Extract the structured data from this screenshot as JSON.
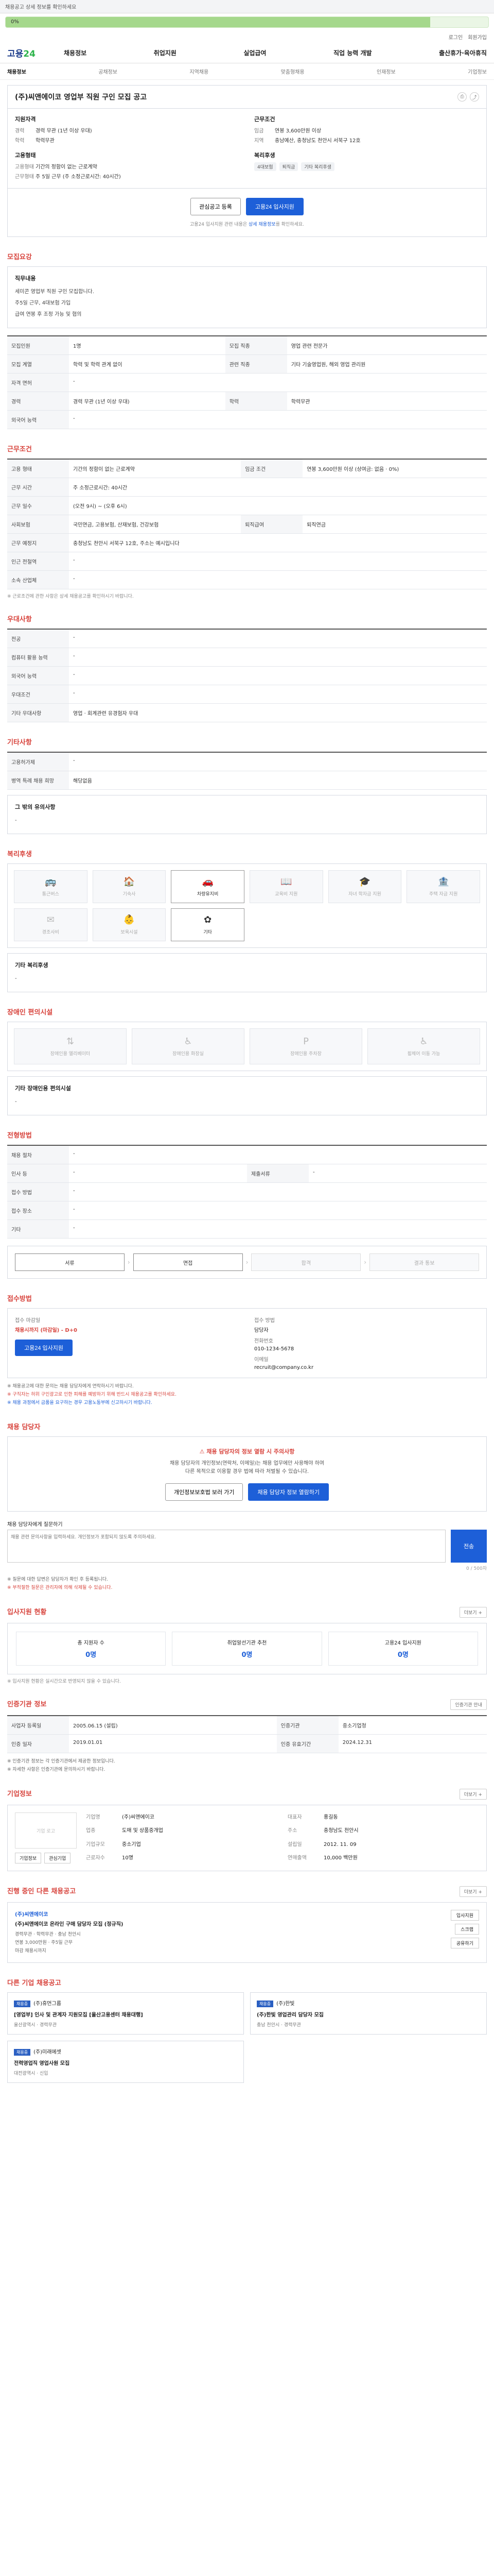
{
  "topbar": {
    "text": "채용공고 상세 정보를 확인하세요"
  },
  "progress": {
    "text": "0%",
    "fraction": 0.88
  },
  "util": [
    "로그인",
    "회원가입"
  ],
  "gnb": {
    "logo_main": "고용",
    "logo_accent": "24",
    "menu": [
      "채용정보",
      "취업지원",
      "실업급여",
      "직업 능력 개발",
      "출산휴가·육아휴직"
    ]
  },
  "subnav": [
    "채용정보",
    "공채정보",
    "지역채용",
    "맞춤형채용",
    "인재정보",
    "기업정보"
  ],
  "job": {
    "title": "(주)씨앤에이코 영업부 직원 구인 모집 공고",
    "recruit_label": "지원자격",
    "recruit_rows": [
      [
        "경력",
        "경력 무관 (1년 이상 우대)"
      ],
      [
        "학력",
        "학력무관"
      ]
    ],
    "cond_label": "근무조건",
    "cond_rows": [
      [
        "임금",
        "연봉 3,600만원 이상"
      ],
      [
        "지역",
        "충남예산, 충청남도 천안시 서북구 12호"
      ]
    ],
    "form_label": "고용형태",
    "form_rows": [
      [
        "고용형태",
        "기간의 정함이 없는 근로계약"
      ],
      [
        "근무형태",
        "주 5일 근무 (주 소정근로시간: 40시간)"
      ]
    ],
    "benefit_label": "복리후생",
    "benefit_chips": [
      "4대보험",
      "퇴직금",
      "기타 복리후생"
    ]
  },
  "cta": {
    "scrap": "관심공고 등록",
    "apply": "고용24 입사지원",
    "note_pre": "고용24 입사지원 관련 내용은",
    "note_link": "상세 채용정보",
    "note_post": "를 확인하세요."
  },
  "sec": {
    "job_desc": "모집요강",
    "conditions": "근무조건",
    "prefer": "우대사항",
    "etc": "기타사항",
    "welfare": "복리후생",
    "disability": "장애인 편의시설",
    "process": "전형방법",
    "apply": "접수방법",
    "manager": "채용 담당자",
    "apply_status": "입사지원 현황",
    "cert": "인증기관 정보",
    "company": "기업정보",
    "other": "진행 중인 다른 채용공고",
    "similar": "다른 기업 채용공고"
  },
  "desc": {
    "heading": "직무내용",
    "lines": [
      "세미콘 영업부 직원 구인 모집합니다.",
      "주5일 근무, 4대보험 가입",
      "급여 연봉 후 조정 가능 및 협의"
    ]
  },
  "rows": {
    "recruit": [
      [
        "모집인원",
        "1명",
        "모집 직종",
        "영업 관련 전문가"
      ],
      [
        "모집 계열",
        "학력 및 학력 관계 없이",
        "관련 직종",
        "기타 기술영업원, 해외 영업 관리원"
      ],
      [
        "자격 면허",
        "-",
        "",
        ""
      ],
      [
        "경력",
        "경력 무관 (1년 이상 우대)",
        "학력",
        "학력무관"
      ],
      [
        "외국어 능력",
        "-",
        "",
        ""
      ]
    ],
    "conditions": [
      [
        "고용 형태",
        "기간의 정함이 없는 근로계약",
        "임금 조건",
        "연봉 3,600만원 이상 (상여금: 없음 · 0%)"
      ],
      [
        "근무 시간",
        "주 소정근로시간: 40시간",
        "",
        ""
      ],
      [
        "근무 일수",
        "(오전 9시) ~ (오후 6시)",
        "",
        ""
      ],
      [
        "사회보험",
        "국민연금, 고용보험, 산재보험, 건강보험",
        "퇴직급여",
        "퇴직연금"
      ],
      [
        "근무 예정지",
        "충청남도 천안시 서북구 12호, 주소는 예시입니다",
        "",
        ""
      ],
      [
        "인근 전철역",
        "-",
        "",
        ""
      ],
      [
        "소속 산업체",
        "-",
        "",
        ""
      ]
    ],
    "conditions_note": "※ 근로조건에 관한 사항은 상세 채용공고를 확인하시기 바랍니다.",
    "prefer": [
      [
        "전공",
        "-"
      ],
      [
        "컴퓨터 활용 능력",
        "-"
      ],
      [
        "외국어 능력",
        "-"
      ],
      [
        "우대조건",
        "-"
      ],
      [
        "기타 우대사항",
        "영업 · 회계관련 유경험자 우대"
      ]
    ],
    "etc": [
      [
        "고용허가제",
        "-"
      ],
      [
        "병역 특례 채용 희망",
        "해당없음"
      ]
    ],
    "etc_sub": "그 밖의 유의사항",
    "welfare_icons": [
      "통근버스",
      "기숙사",
      "차량유지비",
      "교육비 지원",
      "자녀 학자금 지원",
      "주택 자금 지원",
      "경조사비",
      "보육시설",
      "기타"
    ],
    "welfare_on": [
      2,
      8
    ],
    "welfare_other_label": "기타 복리후생",
    "disability_icons": [
      "장애인용 엘리베이터",
      "장애인용 화장실",
      "장애인용 주차장",
      "휠체어 이동 가능"
    ],
    "disability_other_label": "기타 장애인용 편의시설",
    "process": [
      [
        "채용 절차",
        "-",
        "",
        ""
      ],
      [
        "인사 등",
        "-",
        "제출서류",
        "-"
      ],
      [
        "접수 방법",
        "-",
        "",
        ""
      ],
      [
        "접수 장소",
        "-",
        "",
        ""
      ],
      [
        "기타",
        "-",
        "",
        ""
      ]
    ],
    "steps": [
      "서류",
      "면접",
      "합격",
      "결과 통보"
    ],
    "steps_on": [
      0,
      1
    ]
  },
  "apply_block": {
    "period_label": "접수 마감일",
    "period_value": "채용시까지 (마감일) - D+0",
    "btn": "고용24 입사지원",
    "manager_label": "접수 방법",
    "manager_value": "담당자",
    "phone_label": "전화번호",
    "phone_value": "010-1234-5678",
    "email_label": "이메일",
    "email_value": "recruit@company.co.kr"
  },
  "apply_notes": [
    "※ 채용공고에 대한 문의는 채용 담당자에게 연락하시기 바랍니다.",
    "※ 구직자는 허위 구인광고로 인한 피해를 예방하기 위해 반드시 채용공고를 확인하세요.",
    "※ 채용 과정에서 금품을 요구하는 경우 고용노동부에 신고하시기 바랍니다."
  ],
  "alert": {
    "title": "채용 담당자의 정보 열람 시 주의사항",
    "desc1": "채용 담당자의 개인정보(연락처, 이메일)는 채용 업무에만 사용해야 하며",
    "desc2": "다른 목적으로 이용할 경우 법에 따라 처벌될 수 있습니다.",
    "btn1": "개인정보보호법 보러 가기",
    "btn2": "채용 담당자 정보 열람하기"
  },
  "question": {
    "label": "채용 담당자에게 질문하기",
    "placeholder": "채용 관련 문의사항을 입력하세요. 개인정보가 포함되지 않도록 주의하세요.",
    "btn": "전송",
    "counter": "0 / 500자"
  },
  "q_notes": [
    "※ 질문에 대한 답변은 담당자가 확인 후 등록됩니다.",
    "※ 부적절한 질문은 관리자에 의해 삭제될 수 있습니다."
  ],
  "status": {
    "items": [
      [
        "총 지원자 수",
        "0명"
      ],
      [
        "취업알선기관 추천",
        "0명"
      ],
      [
        "고용24 입사지원",
        "0명"
      ]
    ],
    "more": "더보기 +",
    "note": "※ 입사지원 현황은 실시간으로 반영되지 않을 수 있습니다."
  },
  "cert": {
    "more": "인증기관 안내",
    "rows": [
      [
        "사업자 등록일",
        "2005.06.15 (설립)",
        "인증기관",
        "중소기업청"
      ],
      [
        "인증 일자",
        "2019.01.01",
        "인증 유효기간",
        "2024.12.31"
      ]
    ],
    "notes": [
      "※ 인증기관 정보는 각 인증기관에서 제공한 정보입니다.",
      "※ 자세한 사항은 인증기관에 문의하시기 바랍니다."
    ]
  },
  "company": {
    "more": "더보기 +",
    "logo_alt": "기업 로고",
    "btn1": "기업정보",
    "btn2": "관심기업",
    "info": [
      [
        "기업명",
        "(주)씨앤에이코"
      ],
      [
        "대표자",
        "홍길동"
      ],
      [
        "업종",
        "도매 및 상품중개업"
      ],
      [
        "주소",
        "충청남도 천안시"
      ],
      [
        "기업규모",
        "중소기업"
      ],
      [
        "설립일",
        "2012. 11. 09"
      ],
      [
        "근로자수",
        "10명"
      ],
      [
        "연매출액",
        "10,000 백만원"
      ]
    ]
  },
  "other": {
    "more": "더보기 +",
    "co": "(주)씨앤에이코",
    "title": "(주)씨앤에이코 온라인 구매 담당자 모집 (정규직)",
    "meta1": "경력무관 · 학력무관 · 충남 천안시",
    "meta2": "연봉 3,000만원 · 주5일 근무",
    "meta3": "마감 채용시까지",
    "btns": [
      "입사지원",
      "스크랩",
      "공유하기"
    ]
  },
  "similar": {
    "label": "다른 기업 채용공고",
    "cards": [
      {
        "badge": "채용중",
        "co": "(주)휴먼그룹",
        "title": "[영업부] 인사 및 관계자 지원모집 [울산고용센터 채용대행]",
        "meta": "울산광역시 · 경력무관"
      },
      {
        "badge": "채용중",
        "co": "(주)한빛",
        "title": "(주)한빛 영업관리 담당자 모집",
        "meta": "충남 천안시 · 경력무관"
      },
      {
        "badge": "채용중",
        "co": "(주)미래에셋",
        "title": "전력영업직 영업사원 모집",
        "meta": "대전광역시 · 신입"
      }
    ]
  }
}
